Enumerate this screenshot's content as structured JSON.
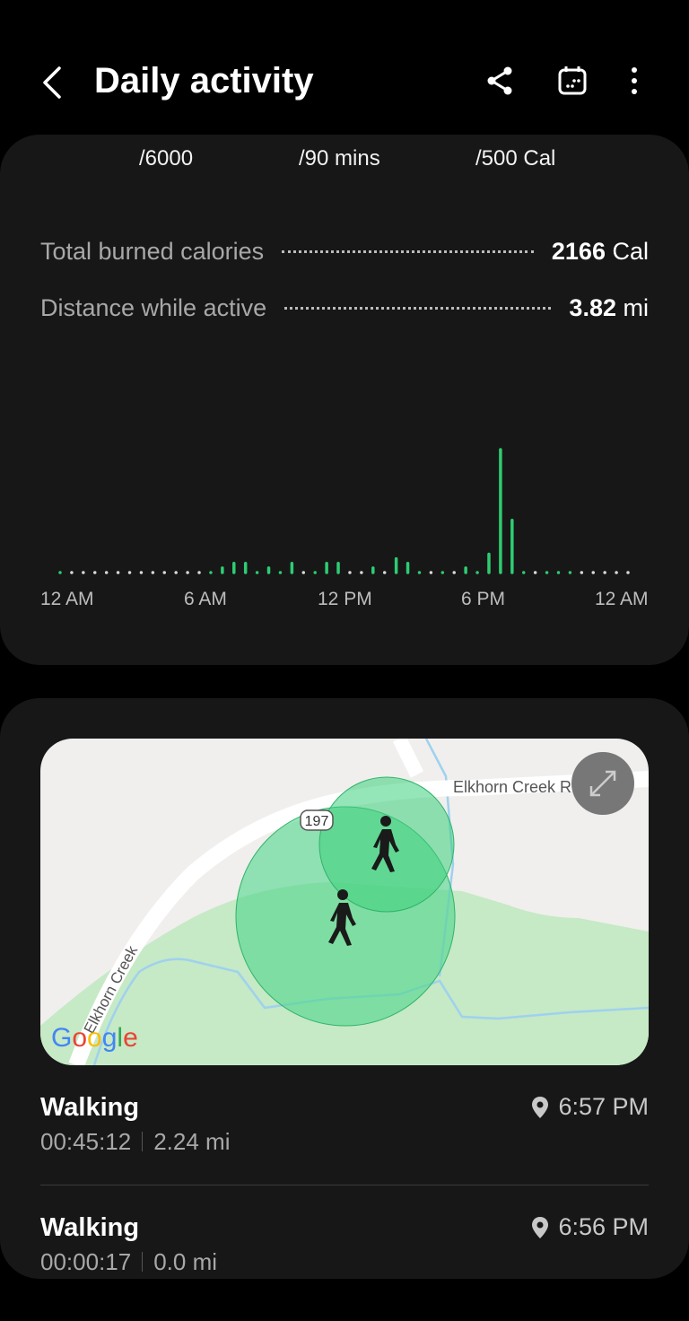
{
  "header": {
    "title": "Daily activity",
    "icons": [
      "back-icon",
      "share-icon",
      "calendar-icon",
      "more-icon"
    ]
  },
  "summary": {
    "goals": [
      "/6000",
      "/90 mins",
      "/500 Cal"
    ],
    "stats": [
      {
        "label": "Total burned calories",
        "value": "2166",
        "unit": "Cal"
      },
      {
        "label": "Distance while active",
        "value": "3.82",
        "unit": "mi"
      }
    ]
  },
  "chart_data": {
    "type": "bar",
    "x_ticks": [
      "12 AM",
      "6 AM",
      "12 PM",
      "6 PM",
      "12 AM"
    ],
    "values": [
      1,
      0,
      0,
      0,
      0,
      0,
      0,
      0,
      0,
      0,
      0,
      0,
      0,
      1,
      3,
      6,
      6,
      1,
      3,
      1,
      6,
      0,
      1,
      6,
      6,
      0,
      0,
      3,
      0,
      9,
      6,
      1,
      0,
      1,
      0,
      3,
      1,
      12,
      80,
      34,
      1,
      0,
      1,
      1,
      1,
      0,
      0,
      0,
      0,
      0
    ],
    "colors": {
      "active": "#2ecc71",
      "inactive": "#d9d9d9"
    }
  },
  "map": {
    "road_label_1": "Elkhorn Creek R",
    "road_label_2": "Elkhorn Creek",
    "route_badge": "197",
    "logo": "Google",
    "expand_icon": "expand-icon"
  },
  "activities": [
    {
      "type": "Walking",
      "duration": "00:45:12",
      "distance": "2.24 mi",
      "time": "6:57 PM"
    },
    {
      "type": "Walking",
      "duration": "00:00:17",
      "distance": "0.0 mi",
      "time": "6:56 PM"
    }
  ]
}
